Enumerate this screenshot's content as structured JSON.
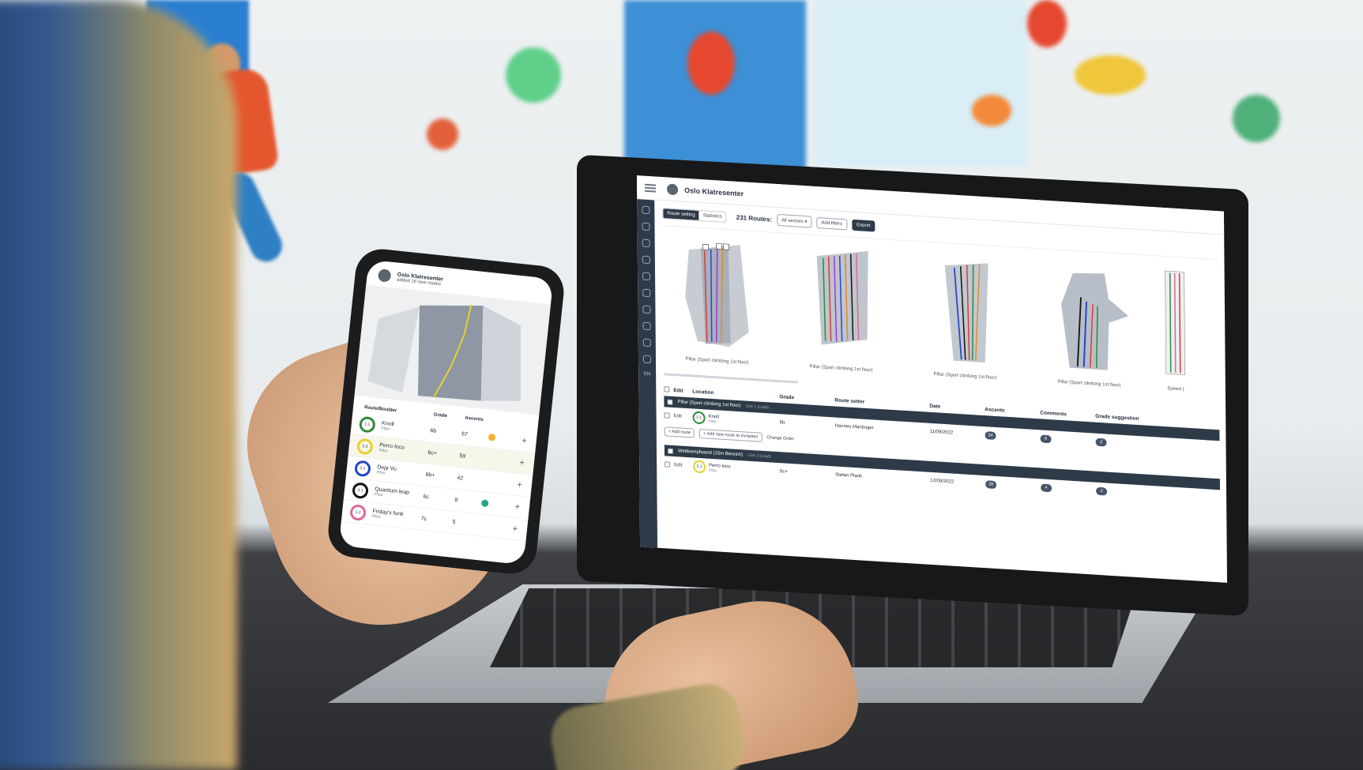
{
  "colors": {
    "accent_dark": "#2d3a48",
    "ring_green": "#2e8b3d",
    "ring_yellow": "#e8d22a",
    "ring_blue": "#1f48c8",
    "ring_black": "#111111",
    "ring_pink": "#e0679a"
  },
  "laptop": {
    "header": {
      "org_name": "Oslo Klatresenter",
      "menu_icon": "hamburger-icon",
      "logo_icon": "org-logo-icon"
    },
    "toolbar": {
      "tabs": [
        "Route setting",
        "Statistics"
      ],
      "routes_count": "231 Routes:",
      "sector_select": "All sectors",
      "add_filters": "Add filters",
      "export": "Export"
    },
    "gallery": {
      "walls": [
        {
          "caption": "Pillar (Sport climbing 1st floor)"
        },
        {
          "caption": "Pillar (Sport climbing 1st floor)"
        },
        {
          "caption": "Pillar (Sport climbing 1st floor)"
        },
        {
          "caption": "Pillar (Sport climbing 1st floor)"
        },
        {
          "caption": "Speed ("
        }
      ]
    },
    "table": {
      "headers": {
        "edit": "Edit",
        "location": "Location",
        "grade": "Grade",
        "route_setter": "Route setter",
        "date": "Date",
        "ascents": "Ascents",
        "comments": "Comments",
        "grade_suggestion": "Grade suggestion"
      },
      "groups": [
        {
          "name": "Pillar (Sport climbing 1st floor)",
          "sub": "Line 1 (Lead)",
          "rows": [
            {
              "edit": "Edit",
              "badge": "1.1",
              "name": "Knoll",
              "area": "Pillar",
              "grade": "6b",
              "setter": "Hannes Mantinger",
              "date": "11/09/2022",
              "ascents": "34",
              "comments": "6",
              "suggestion": "3"
            }
          ],
          "actions": {
            "add_route": "Add route",
            "add_invitation": "Add new route to invitation",
            "change_order": "Change Order"
          }
        },
        {
          "name": "Wettkampfwand (15m Bereich)",
          "sub": "Line 2 (Lead)",
          "rows": [
            {
              "edit": "Edit",
              "badge": "2.1",
              "name": "Perro loco",
              "area": "Pillar",
              "grade": "6c+",
              "setter": "Stefan Plank",
              "date": "12/09/2022",
              "ascents": "28",
              "comments": "4",
              "suggestion": "2"
            }
          ]
        }
      ]
    },
    "rail": {
      "lang": "EN"
    }
  },
  "phone": {
    "notification": {
      "title": "Oslo Klatresenter",
      "subtitle": "added 16 new routes"
    },
    "headers": {
      "route": "Route/Boulder",
      "grade": "Grade",
      "ascents": "Ascents"
    },
    "rows": [
      {
        "badge": "1.1",
        "name": "Knoll",
        "area": "Pillar",
        "grade": "6b",
        "ascents": "67",
        "ring": "#2e8b3d",
        "dot": "#f2b233"
      },
      {
        "badge": "2.3",
        "name": "Perro loco",
        "area": "Pillar",
        "grade": "6c+",
        "ascents": "59",
        "ring": "#e8d22a",
        "dot": ""
      },
      {
        "badge": "2.2",
        "name": "Deja Vu",
        "area": "Pillar",
        "grade": "6b+",
        "ascents": "42",
        "ring": "#1f48c8",
        "dot": ""
      },
      {
        "badge": "3.1",
        "name": "Quantum leap",
        "area": "Pillar",
        "grade": "6c",
        "ascents": "8",
        "ring": "#111111",
        "dot": "#2aa58a"
      },
      {
        "badge": "1.2",
        "name": "Friday's funk",
        "area": "Pillar",
        "grade": "7c",
        "ascents": "5",
        "ring": "#e0679a",
        "dot": ""
      }
    ]
  }
}
